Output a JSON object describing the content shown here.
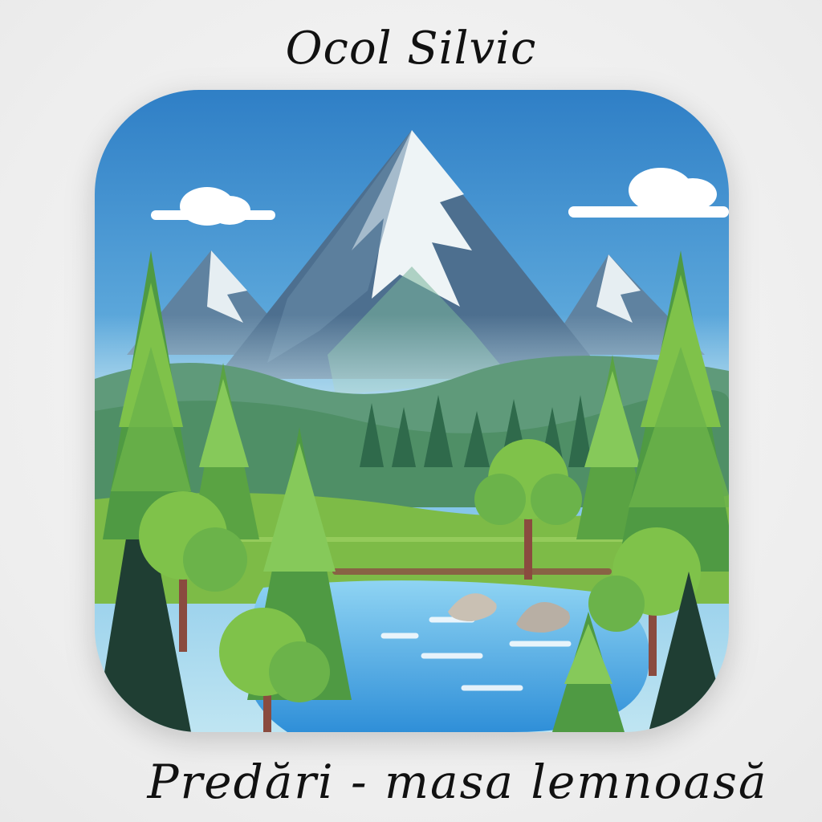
{
  "texts": {
    "top_title": "Ocol Silvic",
    "bottom_title": "Predări - masa lemnoasă"
  },
  "icon": {
    "name": "mountain-forest-lake-icon",
    "colors": {
      "sky_top": "#2f7fc6",
      "sky_bottom": "#9fd6ee",
      "mountain": "#4d6f8f",
      "snow": "#eef4f6",
      "forest_dark": "#2f5b3e",
      "forest_light": "#7fc24a",
      "meadow": "#7dbb47",
      "lake": "#46a9e2",
      "rock": "#c9c0b3"
    }
  }
}
